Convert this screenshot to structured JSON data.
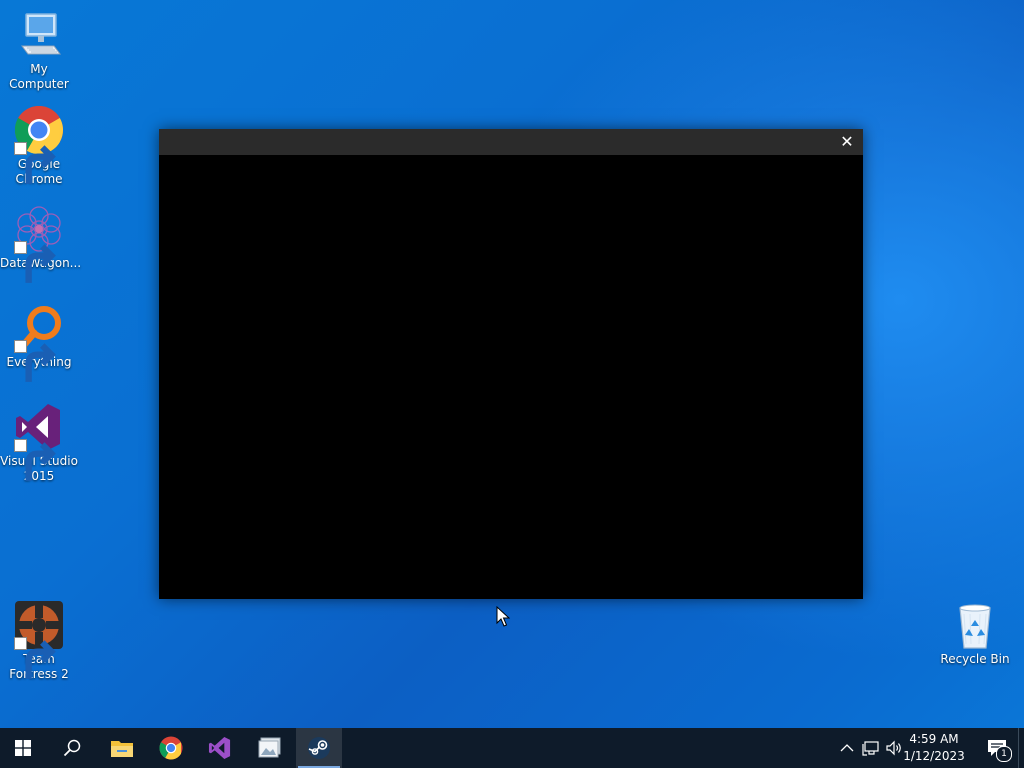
{
  "desktop_icons": [
    {
      "label": "My Computer",
      "icon": "computer-icon"
    },
    {
      "label": "Google Chrome",
      "icon": "chrome-icon"
    },
    {
      "label": "DataWagon...",
      "icon": "datawagon-icon"
    },
    {
      "label": "Everything",
      "icon": "everything-search-icon"
    },
    {
      "label": "Visual Studio 2015",
      "icon": "visual-studio-icon"
    },
    {
      "label": "Team Fortress 2",
      "icon": "team-fortress-icon"
    },
    {
      "label": "Recycle Bin",
      "icon": "recycle-bin-icon"
    }
  ],
  "window": {
    "title": "",
    "close_label": "✕"
  },
  "taskbar": {
    "buttons": [
      {
        "name": "start",
        "icon": "windows-start-icon"
      },
      {
        "name": "search",
        "icon": "search-icon"
      },
      {
        "name": "file-explorer",
        "icon": "folder-icon"
      },
      {
        "name": "chrome",
        "icon": "chrome-icon"
      },
      {
        "name": "visual-studio",
        "icon": "visual-studio-icon"
      },
      {
        "name": "photos",
        "icon": "photos-icon"
      },
      {
        "name": "steam",
        "icon": "steam-icon",
        "active": true
      }
    ],
    "tray": {
      "time": "4:59 AM",
      "date": "1/12/2023",
      "notification_count": "1"
    }
  },
  "colors": {
    "taskbar": "#0e1b2a",
    "window_titlebar": "#2b2b2b",
    "window_body": "#000000"
  }
}
